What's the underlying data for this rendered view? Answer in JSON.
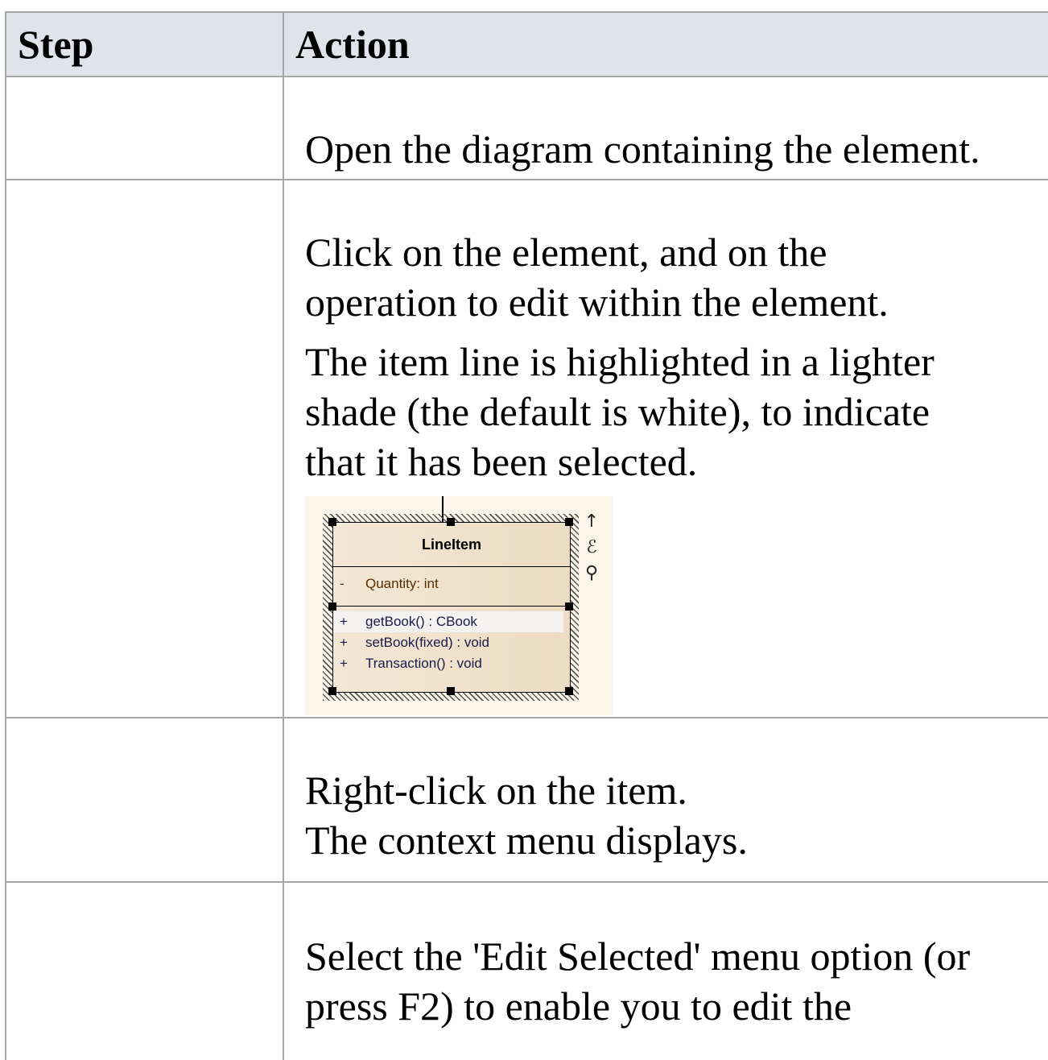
{
  "table": {
    "header": {
      "step": "Step",
      "action": "Action"
    },
    "rows": [
      {
        "step": "",
        "lines": [
          "Open the diagram containing the element."
        ]
      },
      {
        "step": "",
        "para1": [
          "Click on the element, and on the",
          "operation to edit within the element."
        ],
        "para2": [
          "The item line is highlighted in a lighter",
          "shade (the default is white), to indicate",
          "that it has been selected."
        ]
      },
      {
        "step": "",
        "lines": [
          "Right-click on the item.",
          "The context menu displays."
        ]
      },
      {
        "step": "",
        "lines": [
          "Select the 'Edit Selected' menu option (or",
          "press F2) to enable you to edit the"
        ]
      }
    ]
  },
  "diagram": {
    "class_name": "LineItem",
    "attribute": {
      "visibility": "-",
      "text": "Quantity:  int"
    },
    "operations": [
      {
        "visibility": "+",
        "text": "getBook() : CBook",
        "selected": true
      },
      {
        "visibility": "+",
        "text": "setBook(fixed) : void",
        "selected": false
      },
      {
        "visibility": "+",
        "text": "Transaction() : void",
        "selected": false
      }
    ],
    "side_icons": [
      "arrow-up-icon",
      "brush-icon",
      "magnifier-icon"
    ]
  }
}
